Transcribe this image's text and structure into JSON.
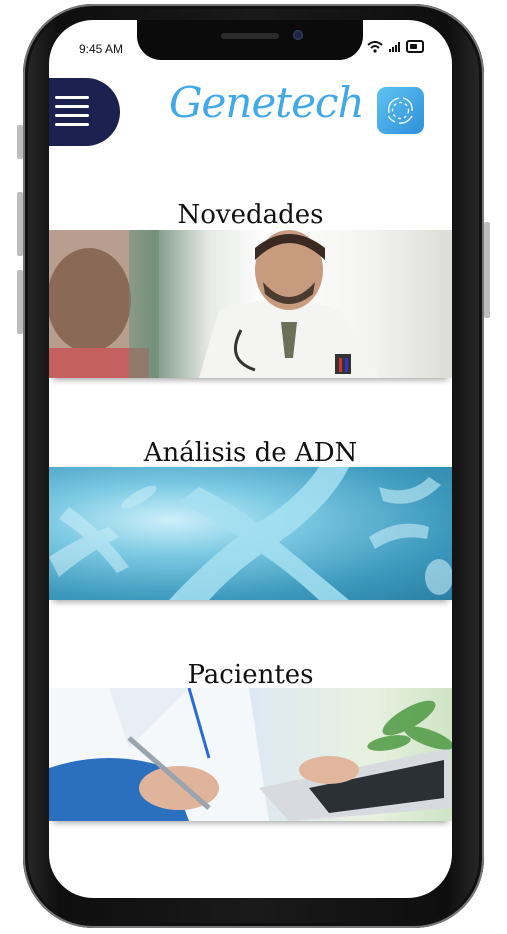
{
  "status_bar": {
    "time": "9:45 AM",
    "icons": [
      "wifi-icon",
      "signal-icon",
      "battery-icon"
    ]
  },
  "header": {
    "menu_icon": "hamburger-menu-icon",
    "logo": "Genetech",
    "app_icon": "app-logo-icon"
  },
  "sections": [
    {
      "title": "Novedades",
      "image": "doctor-consultation-photo"
    },
    {
      "title": "Análisis de ADN",
      "image": "dna-chromosomes-photo"
    },
    {
      "title": "Pacientes",
      "image": "doctor-writing-laptop-photo"
    }
  ],
  "colors": {
    "brand_blue": "#41a9e8",
    "menu_navy": "#1b2250",
    "app_icon_blue": "#2e8fd8"
  }
}
